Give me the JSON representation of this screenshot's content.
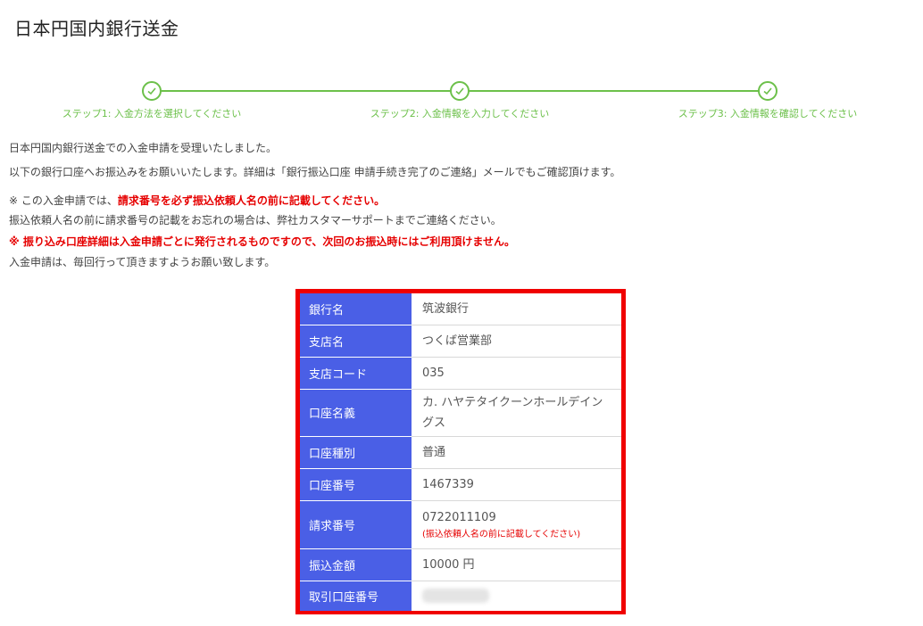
{
  "page": {
    "title": "日本円国内銀行送金"
  },
  "stepper": {
    "steps": [
      {
        "label": "ステップ1: 入金方法を選択してください",
        "status": "complete"
      },
      {
        "label": "ステップ2: 入金情報を入力してください",
        "status": "complete"
      },
      {
        "label": "ステップ3: 入金情報を確認してください",
        "status": "complete"
      }
    ],
    "accent_color": "#6cc04a"
  },
  "messages": {
    "line1": "日本円国内銀行送金での入金申請を受理いたしました。",
    "line2": "以下の銀行口座へお振込みをお願いいたします。詳細は「銀行振込口座 申請手続き完了のご連絡」メールでもご確認頂けます。",
    "line3_prefix": "※ この入金申請では、",
    "line3_emphasis": "請求番号を必ず振込依頼人名の前に記載してください。",
    "line4": "振込依頼人名の前に請求番号の記載をお忘れの場合は、弊社カスタマーサポートまでご連絡ください。",
    "line5": "※ 振り込み口座詳細は入金申請ごとに発行されるものですので、次回のお振込時にはご利用頂けません。",
    "line6": "入金申請は、毎回行って頂きますようお願い致します。"
  },
  "bank": {
    "colors": {
      "header_bg": "#4a5fe6",
      "border": "#f00000"
    },
    "rows": [
      {
        "label": "銀行名",
        "value": "筑波銀行"
      },
      {
        "label": "支店名",
        "value": "つくば営業部"
      },
      {
        "label": "支店コード",
        "value": "035"
      },
      {
        "label": "口座名義",
        "value": "カ. ハヤテタイクーンホールデイン",
        "value2": "グス"
      },
      {
        "label": "口座種別",
        "value": "普通"
      },
      {
        "label": "口座番号",
        "value": "1467339"
      },
      {
        "label": "請求番号",
        "value": "0722011109",
        "note": "(振込依頼人名の前に記載してください)"
      },
      {
        "label": "振込金額",
        "value": "10000 円"
      },
      {
        "label": "取引口座番号",
        "value": ""
      }
    ]
  }
}
